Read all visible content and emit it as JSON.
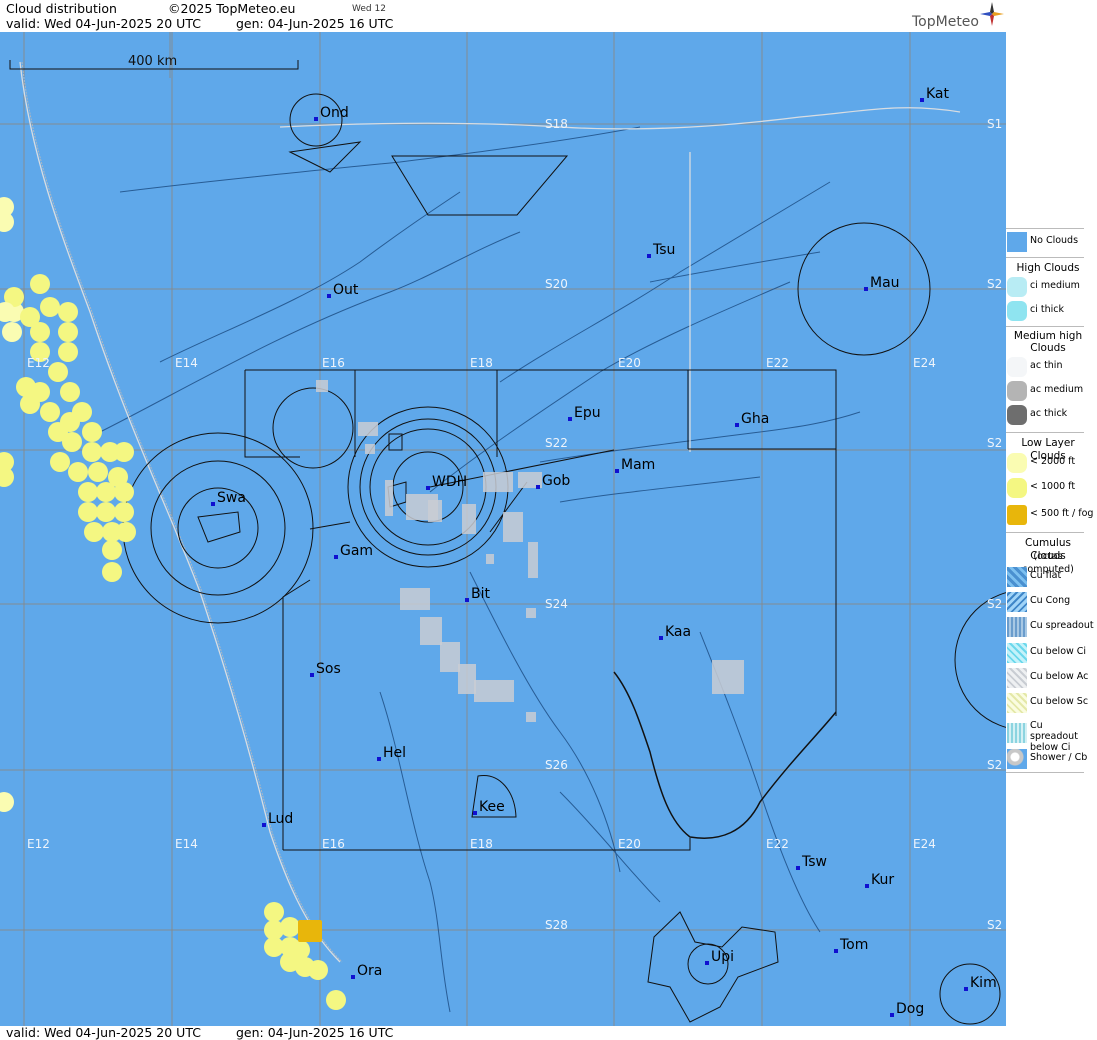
{
  "header": {
    "title": "Cloud distribution",
    "copyright": "©2025 TopMeteo.eu",
    "day_tag": "Wed 12",
    "valid": "valid:  Wed  04-Jun-2025  20 UTC",
    "gen": "gen: 04-Jun-2025 16 UTC",
    "brand": "TopMeteo"
  },
  "footer": {
    "valid": "valid:  Wed  04-Jun-2025  20 UTC",
    "gen": "gen: 04-Jun-2025 16 UTC"
  },
  "scale_label": "400 km",
  "grid_labels": {
    "lon_top": [
      "E12",
      "E14",
      "E16",
      "E18",
      "E20",
      "E22",
      "E24"
    ],
    "lon_bottom": [
      "E12",
      "E14",
      "E16",
      "E18",
      "E20",
      "E22",
      "E24"
    ],
    "lat_mid": [
      "S18",
      "S20",
      "S22",
      "S24",
      "S26",
      "S28"
    ],
    "lat_edge": [
      "S1",
      "S2",
      "S2",
      "S2",
      "S2",
      "S2"
    ]
  },
  "places": [
    {
      "code": "Ond"
    },
    {
      "code": "Kat"
    },
    {
      "code": "Tsu"
    },
    {
      "code": "Mau"
    },
    {
      "code": "Out"
    },
    {
      "code": "Epu"
    },
    {
      "code": "Gha"
    },
    {
      "code": "Mam"
    },
    {
      "code": "WDH"
    },
    {
      "code": "Gob"
    },
    {
      "code": "Swa"
    },
    {
      "code": "Gam"
    },
    {
      "code": "Bit"
    },
    {
      "code": "Kaa"
    },
    {
      "code": "Sos"
    },
    {
      "code": "Hel"
    },
    {
      "code": "Lud"
    },
    {
      "code": "Kee"
    },
    {
      "code": "Tsw"
    },
    {
      "code": "Kur"
    },
    {
      "code": "Tom"
    },
    {
      "code": "Upi"
    },
    {
      "code": "Ora"
    },
    {
      "code": "Kim"
    },
    {
      "code": "Dog"
    }
  ],
  "colors": {
    "no_clouds": "#5fa8ea",
    "low_2000": "#fafcb2",
    "low_1000": "#f4f782",
    "low_500_fog": "#e8b60b",
    "cu_below_ac": "#c9cdd3"
  },
  "legend": {
    "no_clouds": "No Clouds",
    "high_title": "High Clouds",
    "high_items": [
      "ci medium",
      "ci thick"
    ],
    "medium_title_1": "Medium high",
    "medium_title_2": "Clouds",
    "medium_items": [
      "ac thin",
      "ac medium",
      "ac thick"
    ],
    "low_title": "Low Layer Clouds",
    "low_items": [
      "< 2000 ft",
      "< 1000 ft",
      "< 500 ft / fog"
    ],
    "cumulus_title": "Cumulus Clouds",
    "cumulus_sub": "(octas computed)",
    "cumulus_items": [
      "Cu flat",
      "Cu Cong",
      "Cu spreadout",
      "Cu below Ci",
      "Cu below Ac",
      "Cu below Sc",
      "Cu spreadout below Ci",
      "Shower / Cb"
    ]
  }
}
